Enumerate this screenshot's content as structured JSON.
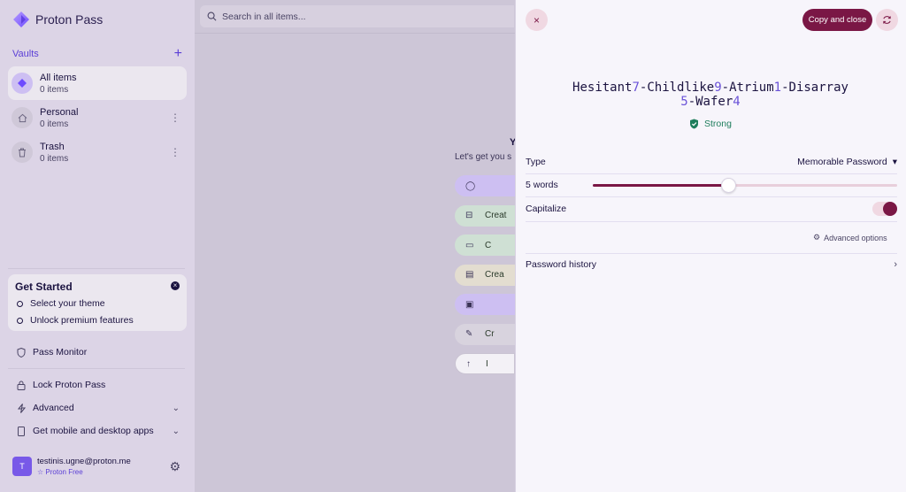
{
  "brand": {
    "name": "Proton Pass"
  },
  "sidebar": {
    "vaults_title": "Vaults",
    "vaults": [
      {
        "name": "All items",
        "count": "0 items",
        "icon": "diamond-icon"
      },
      {
        "name": "Personal",
        "count": "0 items",
        "icon": "home-icon"
      },
      {
        "name": "Trash",
        "count": "0 items",
        "icon": "trash-icon"
      }
    ],
    "get_started": {
      "title": "Get Started",
      "items": [
        "Select your theme",
        "Unlock premium features"
      ]
    },
    "menu": {
      "pass_monitor": "Pass Monitor",
      "lock": "Lock Proton Pass",
      "advanced": "Advanced",
      "get_apps": "Get mobile and desktop apps"
    },
    "account": {
      "avatar_letter": "T",
      "email": "testinis.ugne@proton.me",
      "plan": "Proton Free"
    }
  },
  "search": {
    "placeholder": "Search in all items..."
  },
  "middle": {
    "empty_title": "Y",
    "empty_subtitle": "Let's get you s",
    "create_buttons": [
      {
        "label": "",
        "icon": "user-icon",
        "color": "#cdbff2"
      },
      {
        "label": "Creat",
        "icon": "car-icon",
        "color": "#cfe0d4"
      },
      {
        "label": "C",
        "icon": "card-icon",
        "color": "#cfe0d4"
      },
      {
        "label": "Crea",
        "icon": "note-icon",
        "color": "#e3ddd0"
      },
      {
        "label": "",
        "icon": "id-card-icon",
        "color": "#cdbff2"
      },
      {
        "label": "Cr",
        "icon": "wrench-icon",
        "color": "#d8d3de"
      },
      {
        "label": "I",
        "icon": "upload-icon",
        "color": "#f3f1f6"
      }
    ]
  },
  "panel": {
    "copy_label": "Copy and close",
    "password_parts": [
      {
        "t": "Hesitant",
        "d": false
      },
      {
        "t": "7",
        "d": true
      },
      {
        "t": "-Childlike",
        "d": false
      },
      {
        "t": "9",
        "d": true
      },
      {
        "t": "-Atrium",
        "d": false
      },
      {
        "t": "1",
        "d": true
      },
      {
        "t": "-Disarray",
        "d": false
      },
      {
        "t": "5",
        "d": true
      },
      {
        "t": "-Wafer",
        "d": false
      },
      {
        "t": "4",
        "d": true
      }
    ],
    "strength": "Strong",
    "type_label": "Type",
    "type_value": "Memorable Password",
    "words_label": "5 words",
    "words_fraction": 0.445,
    "capitalize_label": "Capitalize",
    "capitalize_on": true,
    "advanced_options": "Advanced options",
    "history_label": "Password history"
  },
  "colors": {
    "accent": "#7a1745",
    "brand_purple": "#5b3fd6",
    "strong_green": "#1e7d5c"
  }
}
